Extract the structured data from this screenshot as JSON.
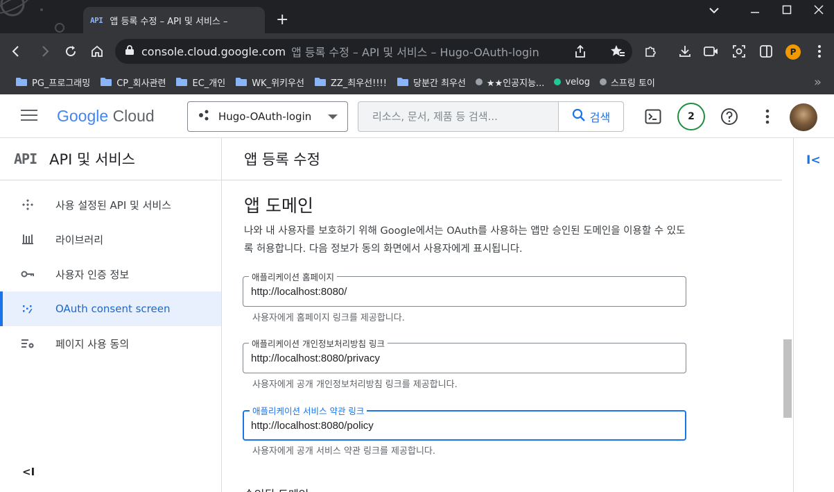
{
  "browser": {
    "tab": {
      "favicon_text": "API",
      "title": "앱 등록 수정 – API 및 서비스 –"
    },
    "new_tab_label": "+",
    "address": {
      "host": "console.cloud.google.com",
      "rest": "앱 등록 수정 – API 및 서비스 – Hugo-OAuth-login"
    },
    "profile_initial": "P",
    "bookmarks": [
      {
        "label": "PG_프로그래밍",
        "icon": "folder-icon"
      },
      {
        "label": "CP_회사관련",
        "icon": "folder-icon"
      },
      {
        "label": "EC_개인",
        "icon": "folder-icon"
      },
      {
        "label": "WK_위키우선",
        "icon": "folder-icon"
      },
      {
        "label": "ZZ_최우선!!!!",
        "icon": "folder-icon"
      },
      {
        "label": "당분간 최우선",
        "icon": "folder-icon"
      },
      {
        "label": "★★인공지능...",
        "icon": "dot-icon",
        "color": "#9aa0a6"
      },
      {
        "label": "velog",
        "icon": "dot-icon",
        "color": "#20c997"
      },
      {
        "label": "스프링 토이",
        "icon": "dot-icon",
        "color": "#9aa0a6"
      }
    ],
    "bookmarks_more": "»"
  },
  "header": {
    "logo_google": "Google",
    "logo_cloud": "Cloud",
    "project_name": "Hugo-OAuth-login",
    "search_placeholder": "리소스, 문서, 제품 등 검색...",
    "search_button": "검색",
    "notification_count": "2"
  },
  "sidebar": {
    "title": "API 및 서비스",
    "logo_text": "API",
    "items": [
      {
        "label": "사용 설정된 API 및 서비스",
        "icon": "api-diamond-icon"
      },
      {
        "label": "라이브러리",
        "icon": "library-icon"
      },
      {
        "label": "사용자 인증 정보",
        "icon": "key-icon"
      },
      {
        "label": "OAuth consent screen",
        "icon": "oauth-icon",
        "active": true
      },
      {
        "label": "페이지 사용 동의",
        "icon": "settings-list-icon"
      }
    ],
    "collapse_label": "<I"
  },
  "main": {
    "page_title": "앱 등록 수정",
    "section_title": "앱 도메인",
    "section_desc": "나와 내 사용자를 보호하기 위해 Google에서는 OAuth를 사용하는 앱만 승인된 도메인을 이용할 수 있도록 허용합니다. 다음 정보가 동의 화면에서 사용자에게 표시됩니다.",
    "fields": [
      {
        "label": "애플리케이션 홈페이지",
        "value": "http://localhost:8080/",
        "helper": "사용자에게 홈페이지 링크를 제공합니다."
      },
      {
        "label": "애플리케이션 개인정보처리방침 링크",
        "value": "http://localhost:8080/privacy",
        "helper": "사용자에게 공개 개인정보처리방침 링크를 제공합니다."
      },
      {
        "label": "애플리케이션 서비스 약관 링크",
        "value": "http://localhost:8080/policy",
        "helper": "사용자에게 공개 서비스 약관 링크를 제공합니다.",
        "focused": true
      }
    ],
    "next_section_partial": "승인된 도메인"
  },
  "right_panel": {
    "expand_label": "I<"
  },
  "colors": {
    "accent": "#1a73e8",
    "chrome_dark": "#202124",
    "chrome_mid": "#35363a",
    "active_nav_bg": "#e8f0fe",
    "badge_ring": "#1e8e3e"
  }
}
